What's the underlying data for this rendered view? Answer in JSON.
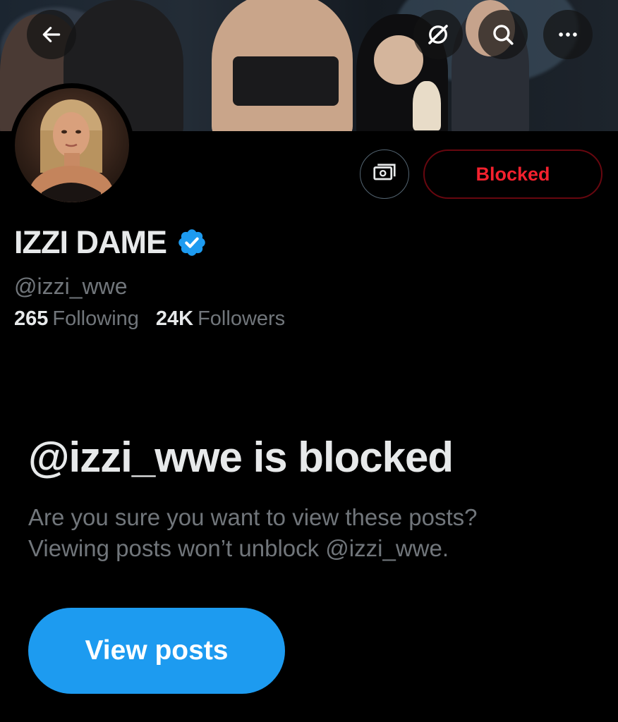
{
  "banner": {
    "back_icon": "arrow-left-icon",
    "grok_icon": "grok-slash-icon",
    "search_icon": "search-icon",
    "more_icon": "more-horizontal-icon"
  },
  "actions": {
    "tip_icon": "money-tip-icon",
    "blocked_label": "Blocked"
  },
  "profile": {
    "display_name": "IZZI DAME",
    "handle": "@izzi_wwe",
    "following_count": "265",
    "following_label": "Following",
    "followers_count": "24K",
    "followers_label": "Followers"
  },
  "notice": {
    "title": "@izzi_wwe is blocked",
    "description_line1": "Are you sure you want to view these posts?",
    "description_line2": "Viewing posts won’t unblock @izzi_wwe.",
    "view_posts_label": "View posts"
  },
  "colors": {
    "background": "#000000",
    "primary_text": "#e7e9ea",
    "secondary_text": "#71767b",
    "accent_blue": "#1d9bf0",
    "blocked_red": "#f4212e",
    "verified_blue": "#1d9bf0"
  }
}
